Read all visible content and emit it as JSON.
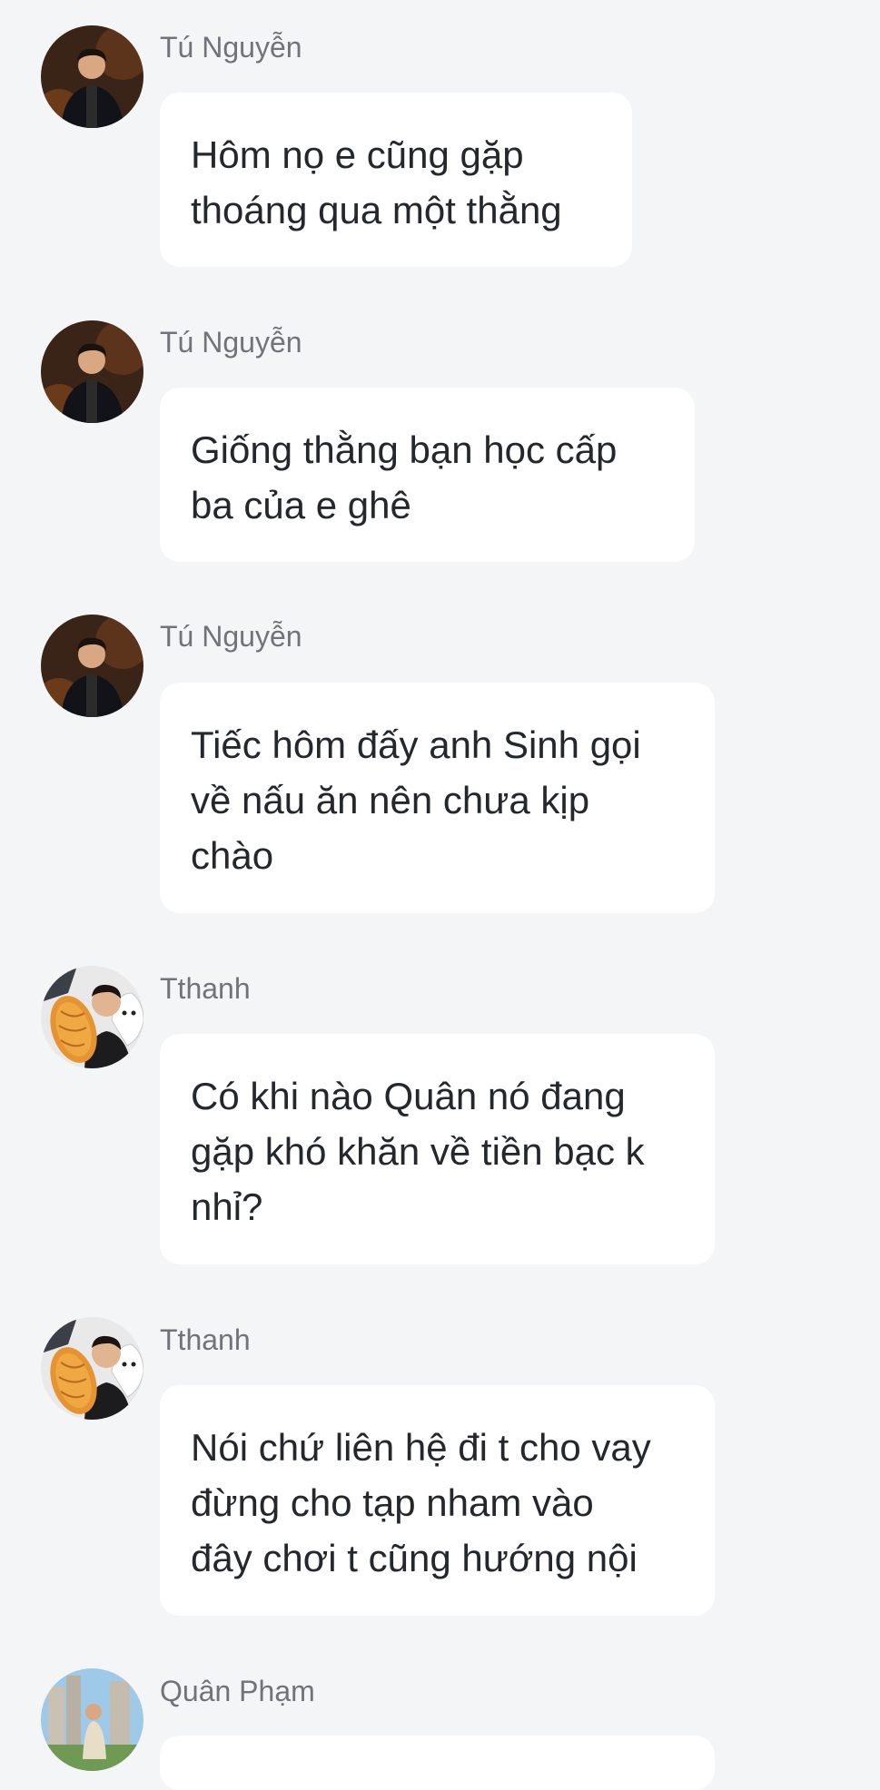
{
  "messages": [
    {
      "sender": "Tú Nguyễn",
      "avatar": "avatar-man-dark-suit",
      "text": "Hôm nọ e cũng gặp\nthoáng qua một thằng"
    },
    {
      "sender": "Tú Nguyễn",
      "avatar": "avatar-man-dark-suit",
      "text": "Giống thằng bạn học cấp\nba của e ghê"
    },
    {
      "sender": "Tú Nguyễn",
      "avatar": "avatar-man-dark-suit",
      "text": "Tiếc hôm đấy anh Sinh gọi\nvề nấu ăn nên chưa kịp\nchào"
    },
    {
      "sender": "Tthanh",
      "avatar": "avatar-man-holding-bread",
      "text": "Có khi nào Quân nó đang\ngặp khó khăn về tiền bạc k\nnhỉ?"
    },
    {
      "sender": "Tthanh",
      "avatar": "avatar-man-holding-bread",
      "text": "Nói chứ liên hệ đi t cho vay\nđừng cho tạp nham vào\nđây chơi t cũng hướng nội"
    },
    {
      "sender": "Quân Phạm",
      "avatar": "avatar-man-outdoor",
      "text": ""
    }
  ]
}
